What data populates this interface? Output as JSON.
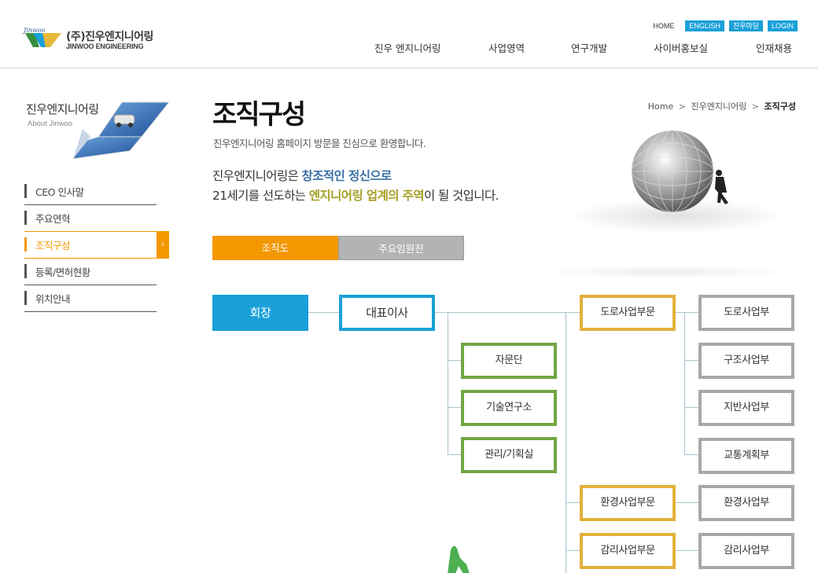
{
  "header": {
    "logo": {
      "small": "Jinwoo",
      "kr": "(주)진우엔지니어링",
      "en": "JINWOO ENGINEERING"
    },
    "util": {
      "home": "HOME",
      "english": "ENGLISH",
      "community": "진우마당",
      "login": "LOGIN"
    },
    "gnb": [
      "진우 엔지니어링",
      "사업영역",
      "연구개발",
      "사이버홍보실",
      "인재채용"
    ]
  },
  "lnb": {
    "title": "진우엔지니어링",
    "subtitle": "About Jinwoo",
    "items": [
      {
        "label": "CEO 인사말"
      },
      {
        "label": "주요연혁"
      },
      {
        "label": "조직구성",
        "go": "›"
      },
      {
        "label": "등록/면허현황"
      },
      {
        "label": "위치안내"
      }
    ]
  },
  "content": {
    "title": "조직구성",
    "welcome": "진우엔지니어링 홈페이지 방문을 진심으로 환영합니다.",
    "breadcrumb": {
      "home": "Home",
      "sep": ">",
      "level1": "진우엔지니어링",
      "current": "조직구성"
    },
    "slogan": {
      "l1_a": "진우엔지니어링은 ",
      "l1_b": "창조적인 정신으로",
      "l2_a": "21세기를 선도하는 ",
      "l2_b": "엔지니어링 업계의 주역",
      "l2_c": "이 될 것입니다."
    },
    "tabs": [
      "조직도",
      "주요임원진"
    ]
  },
  "org": {
    "ceo": "회장",
    "rep": "대표이사",
    "staff": [
      "자문단",
      "기술연구소",
      "관리/기획실"
    ],
    "divisions": [
      "도로사업부문",
      "환경사업부문",
      "감리사업부문"
    ],
    "depts": [
      "도로사업부",
      "구조사업부",
      "지반사업부",
      "교통계획부",
      "환경사업부",
      "감리사업부"
    ]
  },
  "colors": {
    "accent_blue": "#1aa0d8",
    "accent_orange": "#f39800",
    "green": "#72a543",
    "gold": "#e2b13c",
    "gray": "#a8a8a8"
  }
}
